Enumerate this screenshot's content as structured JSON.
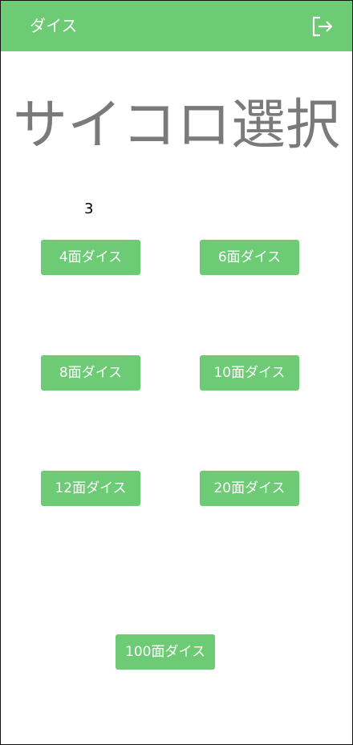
{
  "appbar": {
    "title": "ダイス",
    "logout_icon": "logout-icon"
  },
  "main": {
    "title": "サイコロ選択",
    "count": "3"
  },
  "dice_buttons": [
    {
      "label": "4面ダイス"
    },
    {
      "label": "6面ダイス"
    },
    {
      "label": "8面ダイス"
    },
    {
      "label": "10面ダイス"
    },
    {
      "label": "12面ダイス"
    },
    {
      "label": "20面ダイス"
    },
    {
      "label": "100面ダイス"
    }
  ],
  "colors": {
    "accent": "#6ccb74",
    "title_text": "#7a7a7a"
  }
}
